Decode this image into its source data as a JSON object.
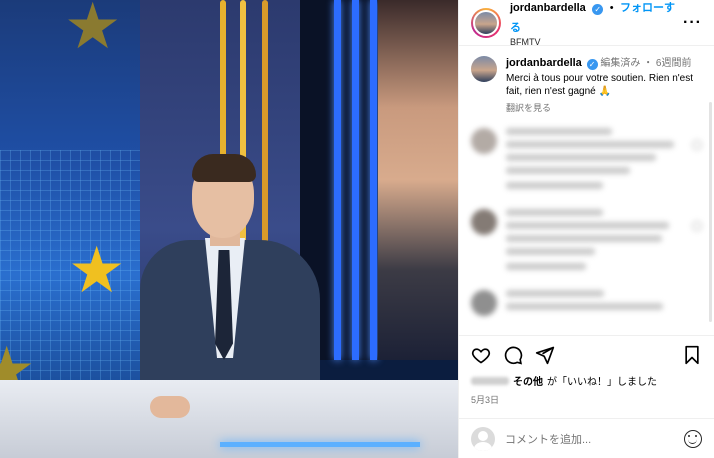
{
  "header": {
    "username": "jordanbardella",
    "follow_label": "フォローする",
    "subtitle": "BFMTV",
    "more_label": "···"
  },
  "caption": {
    "username": "jordanbardella",
    "edited_label": "編集済み",
    "time_ago": "6週間前",
    "text": "Merci à tous pour votre soutien. Rien n'est fait, rien n'est gagné 🙏",
    "translate_label": "翻訳を見る"
  },
  "likes": {
    "text_middle": "その他",
    "text_quote": "が「いいね！」しました"
  },
  "post_date": "5月3日",
  "comment_box": {
    "placeholder": "コメントを追加..."
  },
  "icons": {
    "like": "heart-icon",
    "comment": "comment-icon",
    "share": "send-icon",
    "save": "bookmark-icon",
    "emoji": "emoji-icon"
  },
  "colors": {
    "accent": "#0095f6",
    "verified": "#3897f0"
  }
}
